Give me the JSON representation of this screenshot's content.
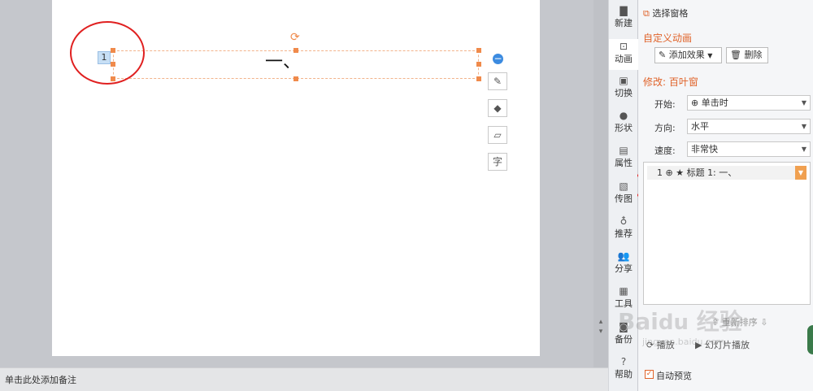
{
  "slide": {
    "title_text": "一、",
    "anim_number": "1"
  },
  "notes_placeholder": "单击此处添加备注",
  "side_tabs": [
    {
      "label": "新建",
      "icon": "new-file-icon"
    },
    {
      "label": "动画",
      "icon": "animation-icon"
    },
    {
      "label": "切换",
      "icon": "transition-icon"
    },
    {
      "label": "形状",
      "icon": "shape-icon"
    },
    {
      "label": "属性",
      "icon": "properties-icon"
    },
    {
      "label": "传图",
      "icon": "upload-image-icon"
    },
    {
      "label": "推荐",
      "icon": "recommend-icon"
    },
    {
      "label": "分享",
      "icon": "share-icon"
    },
    {
      "label": "工具",
      "icon": "toolbox-icon"
    },
    {
      "label": "备份",
      "icon": "backup-icon"
    },
    {
      "label": "帮助",
      "icon": "help-icon"
    }
  ],
  "pane": {
    "select_window": "选择窗格",
    "custom_animation": "自定义动画",
    "add_effect": "添加效果",
    "delete": "删除",
    "modify_title": "修改: 百叶窗",
    "start_label": "开始:",
    "start_value": "单击时",
    "direction_label": "方向:",
    "direction_value": "水平",
    "speed_label": "速度:",
    "speed_value": "非常快",
    "list_item": "1 ⊕  ★  标题 1: 一、",
    "reorder": "重新排序",
    "play": "播放",
    "slideshow": "幻灯片播放",
    "auto_preview": "自动预览"
  },
  "colors": {
    "accent": "#e0632a",
    "annotation": "#e02020",
    "handle": "#f08a4b"
  }
}
